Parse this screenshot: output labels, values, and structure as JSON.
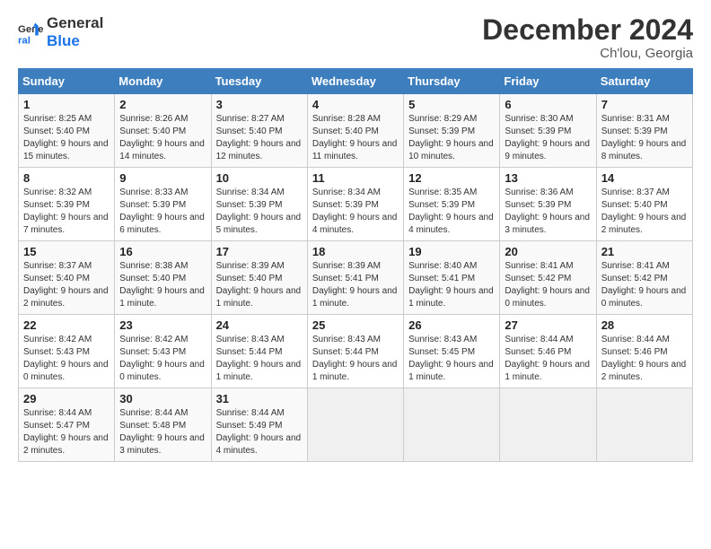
{
  "header": {
    "logo_line1": "General",
    "logo_line2": "Blue",
    "month": "December 2024",
    "location": "Ch'lou, Georgia"
  },
  "days_of_week": [
    "Sunday",
    "Monday",
    "Tuesday",
    "Wednesday",
    "Thursday",
    "Friday",
    "Saturday"
  ],
  "weeks": [
    [
      {
        "day": 1,
        "sunrise": "8:25 AM",
        "sunset": "5:40 PM",
        "daylight": "9 hours and 15 minutes."
      },
      {
        "day": 2,
        "sunrise": "8:26 AM",
        "sunset": "5:40 PM",
        "daylight": "9 hours and 14 minutes."
      },
      {
        "day": 3,
        "sunrise": "8:27 AM",
        "sunset": "5:40 PM",
        "daylight": "9 hours and 12 minutes."
      },
      {
        "day": 4,
        "sunrise": "8:28 AM",
        "sunset": "5:40 PM",
        "daylight": "9 hours and 11 minutes."
      },
      {
        "day": 5,
        "sunrise": "8:29 AM",
        "sunset": "5:39 PM",
        "daylight": "9 hours and 10 minutes."
      },
      {
        "day": 6,
        "sunrise": "8:30 AM",
        "sunset": "5:39 PM",
        "daylight": "9 hours and 9 minutes."
      },
      {
        "day": 7,
        "sunrise": "8:31 AM",
        "sunset": "5:39 PM",
        "daylight": "9 hours and 8 minutes."
      }
    ],
    [
      {
        "day": 8,
        "sunrise": "8:32 AM",
        "sunset": "5:39 PM",
        "daylight": "9 hours and 7 minutes."
      },
      {
        "day": 9,
        "sunrise": "8:33 AM",
        "sunset": "5:39 PM",
        "daylight": "9 hours and 6 minutes."
      },
      {
        "day": 10,
        "sunrise": "8:34 AM",
        "sunset": "5:39 PM",
        "daylight": "9 hours and 5 minutes."
      },
      {
        "day": 11,
        "sunrise": "8:34 AM",
        "sunset": "5:39 PM",
        "daylight": "9 hours and 4 minutes."
      },
      {
        "day": 12,
        "sunrise": "8:35 AM",
        "sunset": "5:39 PM",
        "daylight": "9 hours and 4 minutes."
      },
      {
        "day": 13,
        "sunrise": "8:36 AM",
        "sunset": "5:39 PM",
        "daylight": "9 hours and 3 minutes."
      },
      {
        "day": 14,
        "sunrise": "8:37 AM",
        "sunset": "5:40 PM",
        "daylight": "9 hours and 2 minutes."
      }
    ],
    [
      {
        "day": 15,
        "sunrise": "8:37 AM",
        "sunset": "5:40 PM",
        "daylight": "9 hours and 2 minutes."
      },
      {
        "day": 16,
        "sunrise": "8:38 AM",
        "sunset": "5:40 PM",
        "daylight": "9 hours and 1 minute."
      },
      {
        "day": 17,
        "sunrise": "8:39 AM",
        "sunset": "5:40 PM",
        "daylight": "9 hours and 1 minute."
      },
      {
        "day": 18,
        "sunrise": "8:39 AM",
        "sunset": "5:41 PM",
        "daylight": "9 hours and 1 minute."
      },
      {
        "day": 19,
        "sunrise": "8:40 AM",
        "sunset": "5:41 PM",
        "daylight": "9 hours and 1 minute."
      },
      {
        "day": 20,
        "sunrise": "8:41 AM",
        "sunset": "5:42 PM",
        "daylight": "9 hours and 0 minutes."
      },
      {
        "day": 21,
        "sunrise": "8:41 AM",
        "sunset": "5:42 PM",
        "daylight": "9 hours and 0 minutes."
      }
    ],
    [
      {
        "day": 22,
        "sunrise": "8:42 AM",
        "sunset": "5:43 PM",
        "daylight": "9 hours and 0 minutes."
      },
      {
        "day": 23,
        "sunrise": "8:42 AM",
        "sunset": "5:43 PM",
        "daylight": "9 hours and 0 minutes."
      },
      {
        "day": 24,
        "sunrise": "8:43 AM",
        "sunset": "5:44 PM",
        "daylight": "9 hours and 1 minute."
      },
      {
        "day": 25,
        "sunrise": "8:43 AM",
        "sunset": "5:44 PM",
        "daylight": "9 hours and 1 minute."
      },
      {
        "day": 26,
        "sunrise": "8:43 AM",
        "sunset": "5:45 PM",
        "daylight": "9 hours and 1 minute."
      },
      {
        "day": 27,
        "sunrise": "8:44 AM",
        "sunset": "5:46 PM",
        "daylight": "9 hours and 1 minute."
      },
      {
        "day": 28,
        "sunrise": "8:44 AM",
        "sunset": "5:46 PM",
        "daylight": "9 hours and 2 minutes."
      }
    ],
    [
      {
        "day": 29,
        "sunrise": "8:44 AM",
        "sunset": "5:47 PM",
        "daylight": "9 hours and 2 minutes."
      },
      {
        "day": 30,
        "sunrise": "8:44 AM",
        "sunset": "5:48 PM",
        "daylight": "9 hours and 3 minutes."
      },
      {
        "day": 31,
        "sunrise": "8:44 AM",
        "sunset": "5:49 PM",
        "daylight": "9 hours and 4 minutes."
      },
      null,
      null,
      null,
      null
    ]
  ]
}
